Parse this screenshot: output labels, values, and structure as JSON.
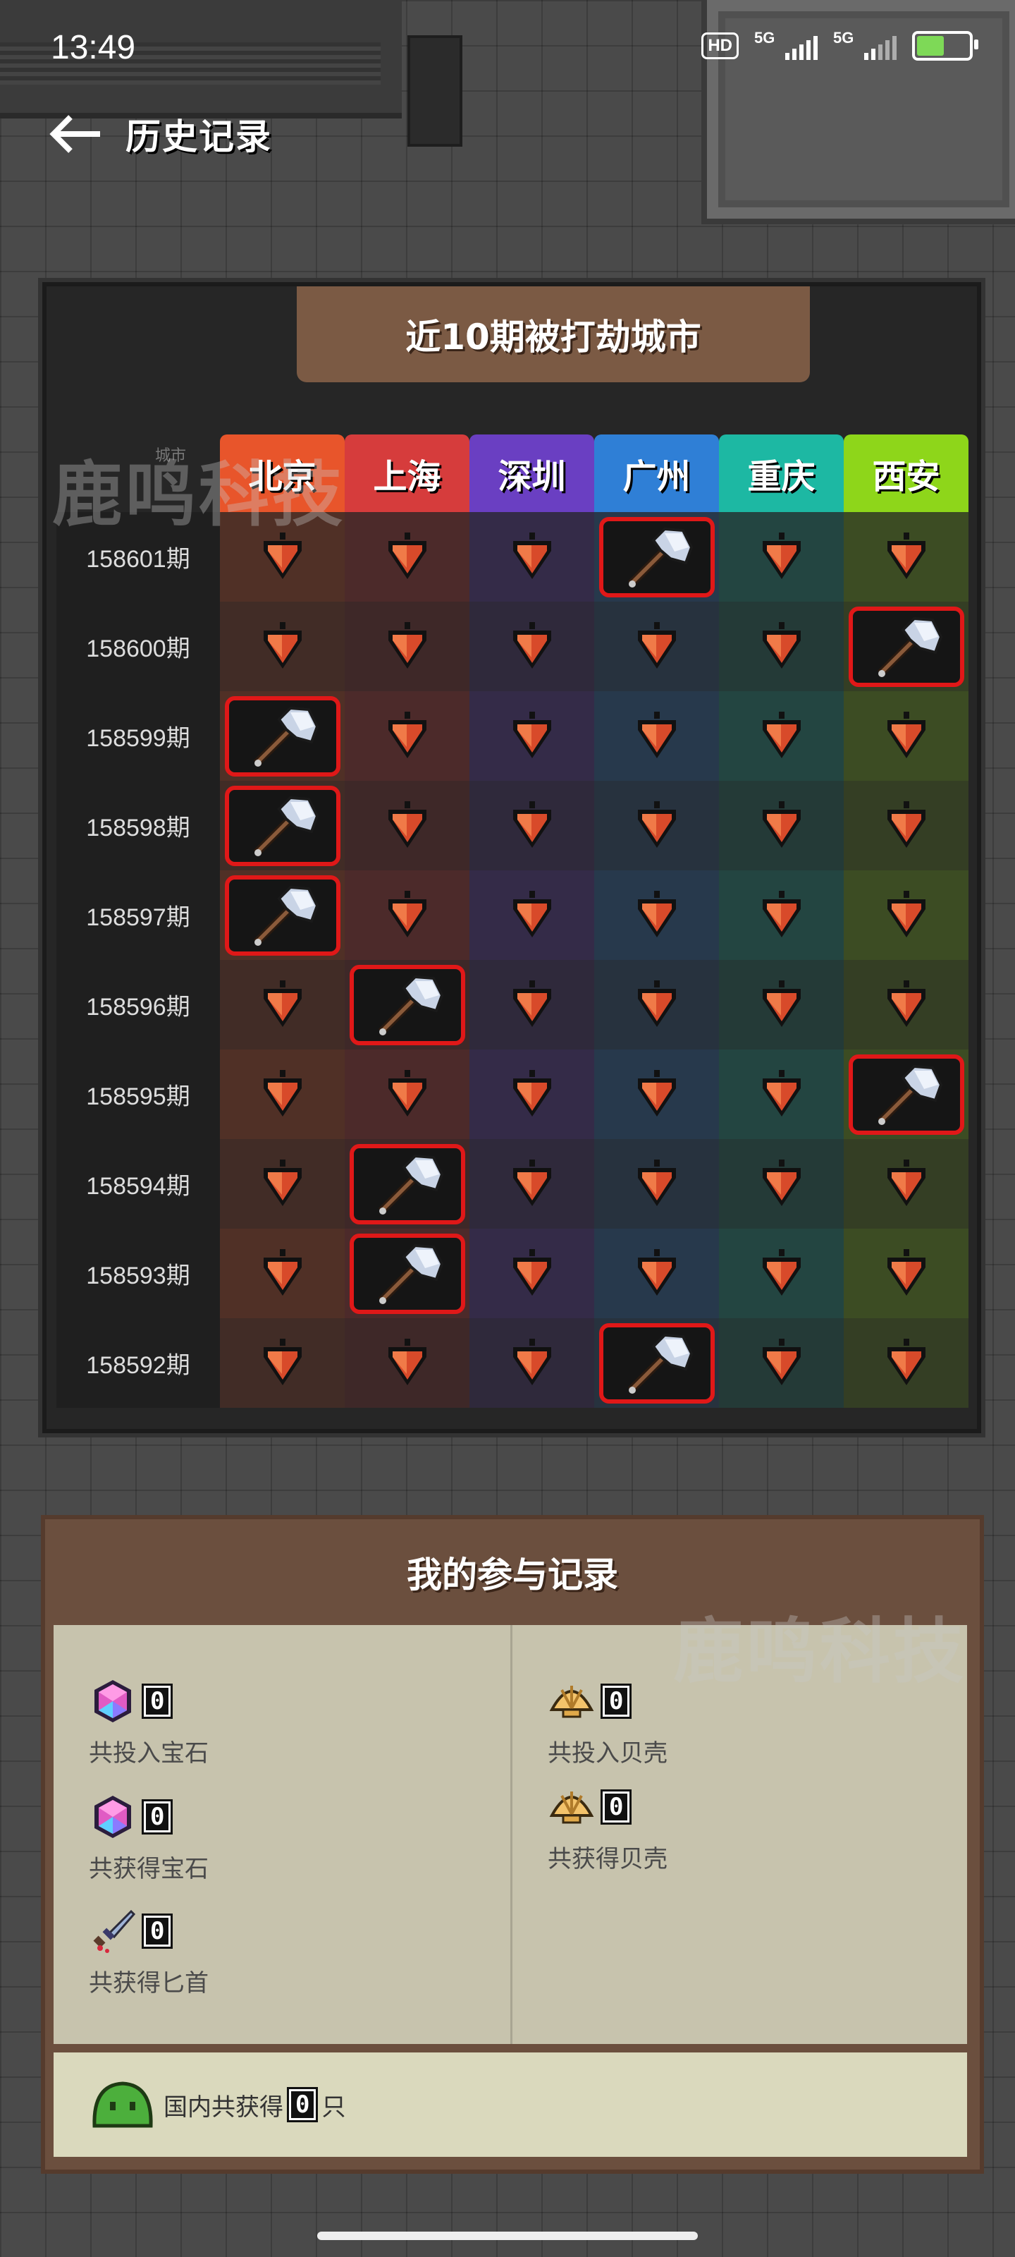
{
  "status_bar": {
    "time": "13:49",
    "hd": "HD",
    "net1": "5G",
    "net2": "5G"
  },
  "header": {
    "title": "历史记录"
  },
  "history": {
    "title": "近10期被打劫城市",
    "corner_label": "城市",
    "cities": [
      {
        "name": "北京",
        "color": "#e8552b"
      },
      {
        "name": "上海",
        "color": "#d63c3c"
      },
      {
        "name": "深圳",
        "color": "#6a3fc2"
      },
      {
        "name": "广州",
        "color": "#2f7fd6"
      },
      {
        "name": "重庆",
        "color": "#1db8a3"
      },
      {
        "name": "西安",
        "color": "#8ed61a"
      }
    ],
    "rows": [
      {
        "period": "158601期",
        "hit": 3
      },
      {
        "period": "158600期",
        "hit": 5
      },
      {
        "period": "158599期",
        "hit": 0
      },
      {
        "period": "158598期",
        "hit": 0
      },
      {
        "period": "158597期",
        "hit": 0
      },
      {
        "period": "158596期",
        "hit": 1
      },
      {
        "period": "158595期",
        "hit": 5
      },
      {
        "period": "158594期",
        "hit": 1
      },
      {
        "period": "158593期",
        "hit": 1
      },
      {
        "period": "158592期",
        "hit": 3
      }
    ]
  },
  "participation": {
    "title": "我的参与记录",
    "gems_invested_count": "0",
    "gems_invested_label": "共投入宝石",
    "gems_earned_count": "0",
    "gems_earned_label": "共获得宝石",
    "dagger_count": "0",
    "dagger_label": "共获得匕首",
    "shells_invested_count": "0",
    "shells_invested_label": "共投入贝壳",
    "shells_earned_count": "0",
    "shells_earned_label": "共获得贝壳",
    "slime_prefix": "国内共获得",
    "slime_count": "0",
    "slime_suffix": "只"
  },
  "watermark": "鹿鸣科技"
}
